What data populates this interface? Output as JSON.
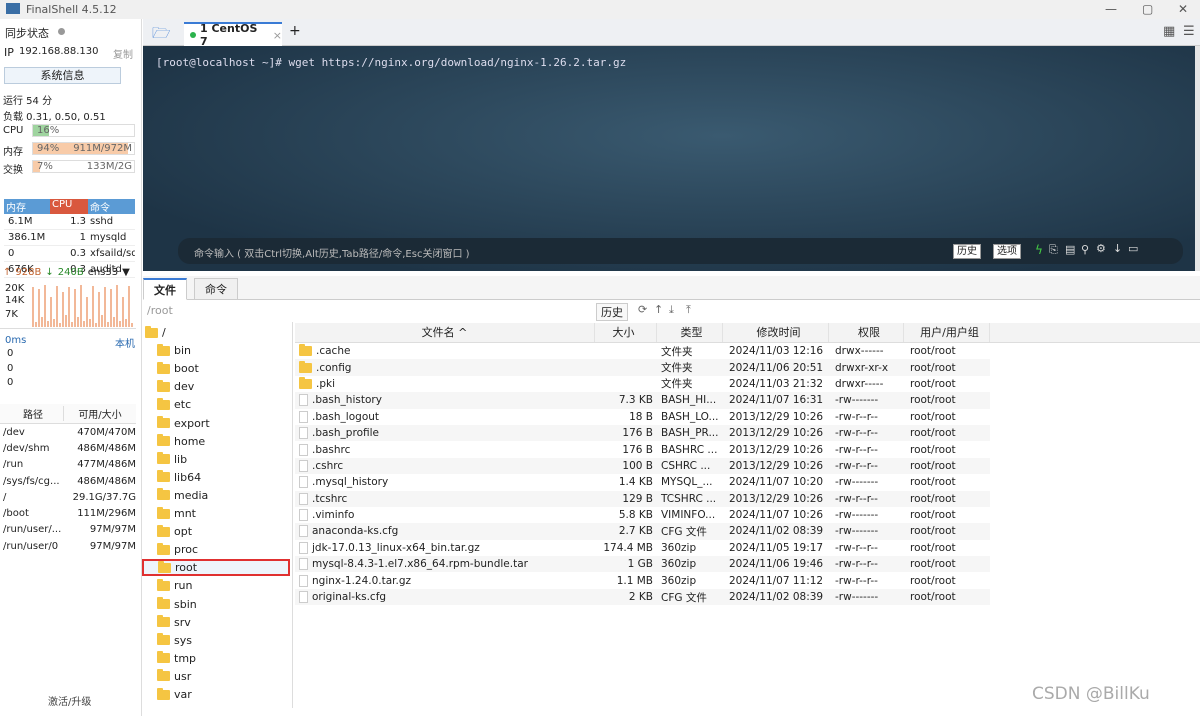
{
  "app": {
    "title": "FinalShell 4.5.12"
  },
  "left": {
    "sync_label": "同步状态",
    "ip_label": "IP",
    "ip": "192.168.88.130",
    "copy": "复制",
    "sysinfo": "系统信息",
    "uptime": "运行 54 分",
    "load": "负载 0.31, 0.50, 0.51",
    "cpu": {
      "label": "CPU",
      "pct": "16%",
      "value": 16
    },
    "mem": {
      "label": "内存",
      "pct": "94%",
      "detail": "911M/972M",
      "value": 94
    },
    "swap": {
      "label": "交换",
      "pct": "7%",
      "detail": "133M/2G",
      "value": 7
    },
    "proc_headers": [
      "内存",
      "CPU",
      "命令"
    ],
    "procs": [
      {
        "mem": "6.1M",
        "cpu": "1.3",
        "cmd": "sshd"
      },
      {
        "mem": "386.1M",
        "cpu": "1",
        "cmd": "mysqld"
      },
      {
        "mem": "0",
        "cpu": "0.3",
        "cmd": "xfsaild/sd.."
      },
      {
        "mem": "676K",
        "cpu": "0.3",
        "cmd": "auditd"
      }
    ],
    "net": {
      "up": "928B",
      "down": "240B",
      "iface": "ens33",
      "ticks": [
        "20K",
        "14K",
        "7K"
      ]
    },
    "ping": {
      "latency": "0ms",
      "host": "本机",
      "vals": [
        "0",
        "0",
        "0"
      ]
    },
    "disk_headers": [
      "路径",
      "可用/大小"
    ],
    "disks": [
      {
        "p": "/dev",
        "s": "470M/470M"
      },
      {
        "p": "/dev/shm",
        "s": "486M/486M"
      },
      {
        "p": "/run",
        "s": "477M/486M"
      },
      {
        "p": "/sys/fs/cg...",
        "s": "486M/486M"
      },
      {
        "p": "/",
        "s": "29.1G/37.7G"
      },
      {
        "p": "/boot",
        "s": "111M/296M"
      },
      {
        "p": "/run/user/...",
        "s": "97M/97M"
      },
      {
        "p": "/run/user/0",
        "s": "97M/97M"
      }
    ],
    "activate": "激活/升级"
  },
  "tabs": [
    {
      "label": "1 CentOS 7"
    }
  ],
  "terminal": {
    "line": "[root@localhost ~]# wget https://nginx.org/download/nginx-1.26.2.tar.gz",
    "hint": "命令输入 ( 双击Ctrl切换,Alt历史,Tab路径/命令,Esc关闭窗口 )",
    "history": "历史",
    "options": "选项"
  },
  "files": {
    "tabs": [
      "文件",
      "命令"
    ],
    "path": "/root",
    "history": "历史",
    "tree": [
      "/",
      "bin",
      "boot",
      "dev",
      "etc",
      "export",
      "home",
      "lib",
      "lib64",
      "media",
      "mnt",
      "opt",
      "proc",
      "root",
      "run",
      "sbin",
      "srv",
      "sys",
      "tmp",
      "usr",
      "var"
    ],
    "selected": "root",
    "headers": [
      "文件名 ^",
      "大小",
      "类型",
      "修改时间",
      "权限",
      "用户/用户组"
    ],
    "rows": [
      {
        "n": ".cache",
        "s": "",
        "t": "文件夹",
        "d": "2024/11/03 12:16",
        "p": "drwx------",
        "u": "root/root",
        "dir": true
      },
      {
        "n": ".config",
        "s": "",
        "t": "文件夹",
        "d": "2024/11/06 20:51",
        "p": "drwxr-xr-x",
        "u": "root/root",
        "dir": true
      },
      {
        "n": ".pki",
        "s": "",
        "t": "文件夹",
        "d": "2024/11/03 21:32",
        "p": "drwxr-----",
        "u": "root/root",
        "dir": true
      },
      {
        "n": ".bash_history",
        "s": "7.3 KB",
        "t": "BASH_HI...",
        "d": "2024/11/07 16:31",
        "p": "-rw-------",
        "u": "root/root"
      },
      {
        "n": ".bash_logout",
        "s": "18 B",
        "t": "BASH_LO...",
        "d": "2013/12/29 10:26",
        "p": "-rw-r--r--",
        "u": "root/root"
      },
      {
        "n": ".bash_profile",
        "s": "176 B",
        "t": "BASH_PR...",
        "d": "2013/12/29 10:26",
        "p": "-rw-r--r--",
        "u": "root/root"
      },
      {
        "n": ".bashrc",
        "s": "176 B",
        "t": "BASHRC ...",
        "d": "2013/12/29 10:26",
        "p": "-rw-r--r--",
        "u": "root/root"
      },
      {
        "n": ".cshrc",
        "s": "100 B",
        "t": "CSHRC ...",
        "d": "2013/12/29 10:26",
        "p": "-rw-r--r--",
        "u": "root/root"
      },
      {
        "n": ".mysql_history",
        "s": "1.4 KB",
        "t": "MYSQL_...",
        "d": "2024/11/07 10:20",
        "p": "-rw-------",
        "u": "root/root"
      },
      {
        "n": ".tcshrc",
        "s": "129 B",
        "t": "TCSHRC ...",
        "d": "2013/12/29 10:26",
        "p": "-rw-r--r--",
        "u": "root/root"
      },
      {
        "n": ".viminfo",
        "s": "5.8 KB",
        "t": "VIMINFO...",
        "d": "2024/11/07 10:26",
        "p": "-rw-------",
        "u": "root/root"
      },
      {
        "n": "anaconda-ks.cfg",
        "s": "2.7 KB",
        "t": "CFG 文件",
        "d": "2024/11/02 08:39",
        "p": "-rw-------",
        "u": "root/root"
      },
      {
        "n": "jdk-17.0.13_linux-x64_bin.tar.gz",
        "s": "174.4 MB",
        "t": "360zip",
        "d": "2024/11/05 19:17",
        "p": "-rw-r--r--",
        "u": "root/root"
      },
      {
        "n": "mysql-8.4.3-1.el7.x86_64.rpm-bundle.tar",
        "s": "1 GB",
        "t": "360zip",
        "d": "2024/11/06 19:46",
        "p": "-rw-r--r--",
        "u": "root/root"
      },
      {
        "n": "nginx-1.24.0.tar.gz",
        "s": "1.1 MB",
        "t": "360zip",
        "d": "2024/11/07 11:12",
        "p": "-rw-r--r--",
        "u": "root/root"
      },
      {
        "n": "original-ks.cfg",
        "s": "2 KB",
        "t": "CFG 文件",
        "d": "2024/11/02 08:39",
        "p": "-rw-------",
        "u": "root/root"
      }
    ]
  },
  "watermark": "CSDN @BillKu"
}
